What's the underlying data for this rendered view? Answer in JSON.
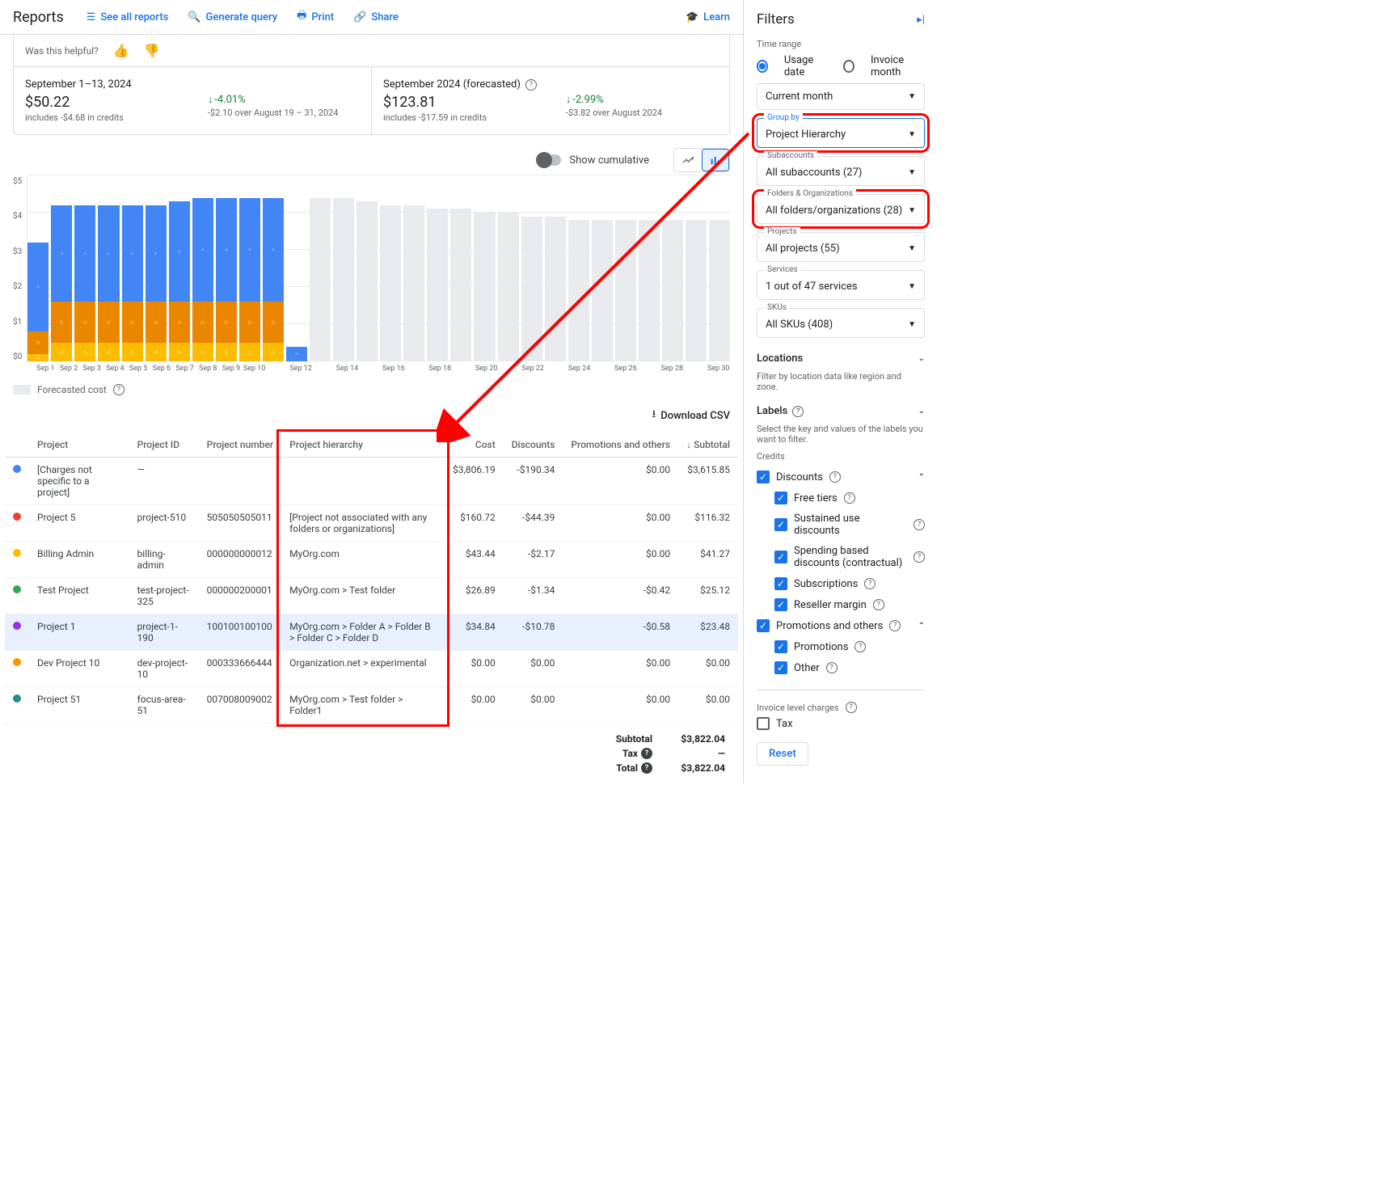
{
  "header": {
    "title": "Reports",
    "actions": {
      "see_all": "See all reports",
      "generate": "Generate query",
      "print": "Print",
      "share": "Share",
      "learn": "Learn"
    }
  },
  "feedback": {
    "prompt": "Was this helpful?"
  },
  "summary": {
    "left": {
      "title": "September 1–13, 2024",
      "value": "$50.22",
      "sub": "includes -$4.68 in credits",
      "change_pct": "-4.01%",
      "change_sub": "-$2.10 over August 19 – 31, 2024"
    },
    "right": {
      "title": "September 2024 (forecasted)",
      "value": "$123.81",
      "sub": "includes -$17.59 in credits",
      "change_pct": "-2.99%",
      "change_sub": "-$3.82 over August 2024"
    }
  },
  "chart_toolbar": {
    "cumulative_label": "Show cumulative"
  },
  "chart_data": {
    "type": "bar",
    "ylim": [
      0,
      5
    ],
    "y_ticks": [
      "$5",
      "$4",
      "$3",
      "$2",
      "$1",
      "$0"
    ],
    "x_labels": [
      "Sep 1",
      "Sep 2",
      "Sep 3",
      "Sep 4",
      "Sep 5",
      "Sep 6",
      "Sep 7",
      "Sep 8",
      "Sep 9",
      "Sep 10",
      "",
      "Sep 12",
      "",
      "Sep 14",
      "",
      "Sep 16",
      "",
      "Sep 18",
      "",
      "Sep 20",
      "",
      "Sep 22",
      "",
      "Sep 24",
      "",
      "Sep 26",
      "",
      "Sep 28",
      "",
      "Sep 30"
    ],
    "series_legend": "Forecasted cost",
    "actual": [
      {
        "blue": 2.4,
        "orange": 0.6,
        "oranged": 0.2
      },
      {
        "blue": 2.6,
        "orange": 1.1,
        "oranged": 0.5
      },
      {
        "blue": 2.6,
        "orange": 1.1,
        "oranged": 0.5
      },
      {
        "blue": 2.6,
        "orange": 1.1,
        "oranged": 0.5
      },
      {
        "blue": 2.6,
        "orange": 1.1,
        "oranged": 0.5
      },
      {
        "blue": 2.6,
        "orange": 1.1,
        "oranged": 0.5
      },
      {
        "blue": 2.7,
        "orange": 1.1,
        "oranged": 0.5
      },
      {
        "blue": 2.8,
        "orange": 1.1,
        "oranged": 0.5
      },
      {
        "blue": 2.8,
        "orange": 1.1,
        "oranged": 0.5
      },
      {
        "blue": 2.8,
        "orange": 1.1,
        "oranged": 0.5
      },
      {
        "blue": 2.8,
        "orange": 1.1,
        "oranged": 0.5
      },
      {
        "blue": 0.4,
        "orange": 0,
        "oranged": 0
      }
    ],
    "forecast_days": 18,
    "forecast_heights": [
      4.4,
      4.4,
      4.3,
      4.2,
      4.2,
      4.1,
      4.1,
      4.0,
      4.0,
      3.9,
      3.9,
      3.8,
      3.8,
      3.8,
      3.8,
      3.8,
      3.8,
      3.8
    ]
  },
  "download": {
    "label": "Download CSV"
  },
  "table": {
    "headers": {
      "project": "Project",
      "project_id": "Project ID",
      "project_number": "Project number",
      "hierarchy": "Project hierarchy",
      "cost": "Cost",
      "discounts": "Discounts",
      "promotions": "Promotions and others",
      "subtotal": "Subtotal"
    },
    "rows": [
      {
        "color": "#4285f4",
        "project": "[Charges not specific to a project]",
        "project_id": "—",
        "project_number": "",
        "hierarchy": "",
        "cost": "$3,806.19",
        "discounts": "-$190.34",
        "promotions": "$0.00",
        "subtotal": "$3,615.85",
        "selected": false
      },
      {
        "color": "#ea4335",
        "project": "Project 5",
        "project_id": "project-510",
        "project_number": "505050505011",
        "hierarchy": "[Project not associated with any folders or organizations]",
        "cost": "$160.72",
        "discounts": "-$44.39",
        "promotions": "$0.00",
        "subtotal": "$116.32",
        "selected": false
      },
      {
        "color": "#fbbc04",
        "project": "Billing Admin",
        "project_id": "billing-admin",
        "project_number": "000000000012",
        "hierarchy": "MyOrg.com",
        "cost": "$43.44",
        "discounts": "-$2.17",
        "promotions": "$0.00",
        "subtotal": "$41.27",
        "selected": false
      },
      {
        "color": "#34a853",
        "project": "Test Project",
        "project_id": "test-project-325",
        "project_number": "000000200001",
        "hierarchy": "MyOrg.com > Test folder",
        "cost": "$26.89",
        "discounts": "-$1.34",
        "promotions": "-$0.42",
        "subtotal": "$25.12",
        "selected": false
      },
      {
        "color": "#9334e6",
        "project": "Project 1",
        "project_id": "project-1-190",
        "project_number": "100100100100",
        "hierarchy": "MyOrg.com > Folder A > Folder B > Folder C > Folder D",
        "cost": "$34.84",
        "discounts": "-$10.78",
        "promotions": "-$0.58",
        "subtotal": "$23.48",
        "selected": true
      },
      {
        "color": "#f29900",
        "project": "Dev Project 10",
        "project_id": "dev-project-10",
        "project_number": "000333666444",
        "hierarchy": "Organization.net > experimental",
        "cost": "$0.00",
        "discounts": "$0.00",
        "promotions": "$0.00",
        "subtotal": "$0.00",
        "selected": false
      },
      {
        "color": "#1e8e8e",
        "project": "Project 51",
        "project_id": "focus-area-51",
        "project_number": "007008009002",
        "hierarchy": "MyOrg.com > Test folder > Folder1",
        "cost": "$0.00",
        "discounts": "$0.00",
        "promotions": "$0.00",
        "subtotal": "$0.00",
        "selected": false
      }
    ],
    "totals": {
      "subtotal_label": "Subtotal",
      "subtotal": "$3,822.04",
      "tax_label": "Tax",
      "tax": "—",
      "total_label": "Total",
      "total": "$3,822.04"
    }
  },
  "filters": {
    "title": "Filters",
    "time_range_label": "Time range",
    "usage_date": "Usage date",
    "invoice_month": "Invoice month",
    "time_select": "Current month",
    "group_by_label": "Group by",
    "group_by": "Project Hierarchy",
    "subaccounts_label": "Subaccounts",
    "subaccounts": "All subaccounts (27)",
    "folders_label": "Folders & Organizations",
    "folders": "All folders/organizations (28)",
    "projects_label": "Projects",
    "projects": "All projects (55)",
    "services_label": "Services",
    "services": "1 out of 47 services",
    "skus_label": "SKUs",
    "skus": "All SKUs (408)",
    "locations_label": "Locations",
    "locations_sub": "Filter by location data like region and zone.",
    "labels_label": "Labels",
    "labels_sub": "Select the key and values of the labels you want to filter.",
    "credits_label": "Credits",
    "discounts_label": "Discounts",
    "credits": {
      "free_tiers": "Free tiers",
      "sustained": "Sustained use discounts",
      "spending": "Spending based discounts (contractual)",
      "subscriptions": "Subscriptions",
      "reseller": "Reseller margin"
    },
    "promotions_label": "Promotions and others",
    "promotions": "Promotions",
    "other": "Other",
    "invoice_charges_label": "Invoice level charges",
    "tax_label": "Tax",
    "reset": "Reset"
  }
}
